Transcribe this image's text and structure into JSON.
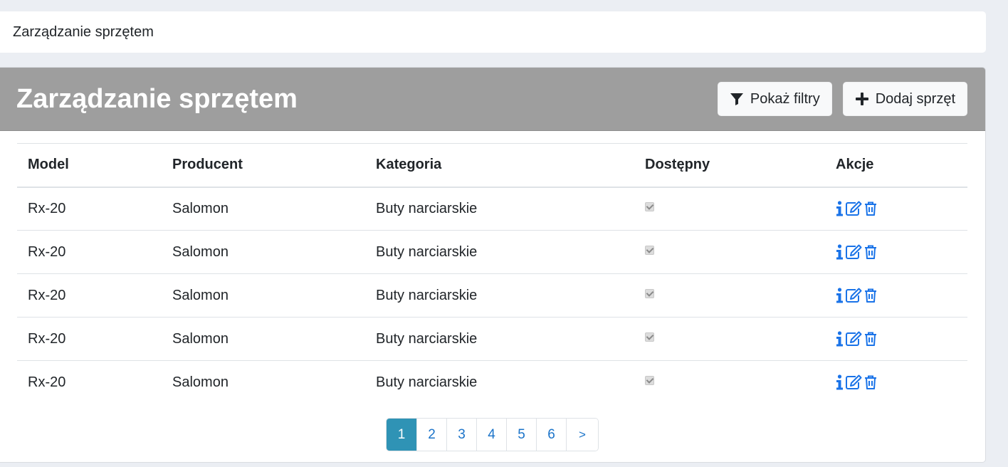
{
  "breadcrumb": "Zarządzanie sprzętem",
  "header": {
    "title": "Zarządzanie sprzętem",
    "filter_button": "Pokaż filtry",
    "add_button": "Dodaj sprzęt"
  },
  "table": {
    "columns": [
      "Model",
      "Producent",
      "Kategoria",
      "Dostępny",
      "Akcje"
    ],
    "rows": [
      {
        "model": "Rx-20",
        "producer": "Salomon",
        "category": "Buty narciarskie",
        "available": true
      },
      {
        "model": "Rx-20",
        "producer": "Salomon",
        "category": "Buty narciarskie",
        "available": true
      },
      {
        "model": "Rx-20",
        "producer": "Salomon",
        "category": "Buty narciarskie",
        "available": true
      },
      {
        "model": "Rx-20",
        "producer": "Salomon",
        "category": "Buty narciarskie",
        "available": true
      },
      {
        "model": "Rx-20",
        "producer": "Salomon",
        "category": "Buty narciarskie",
        "available": true
      }
    ],
    "row_actions": [
      "info-icon",
      "edit-icon",
      "trash-icon"
    ]
  },
  "pagination": {
    "pages": [
      "1",
      "2",
      "3",
      "4",
      "5",
      "6"
    ],
    "active": "1",
    "next_label": ">"
  },
  "colors": {
    "header_bg": "#9e9e9e",
    "action_blue": "#1a73e8",
    "active_page": "#2f93b5"
  }
}
